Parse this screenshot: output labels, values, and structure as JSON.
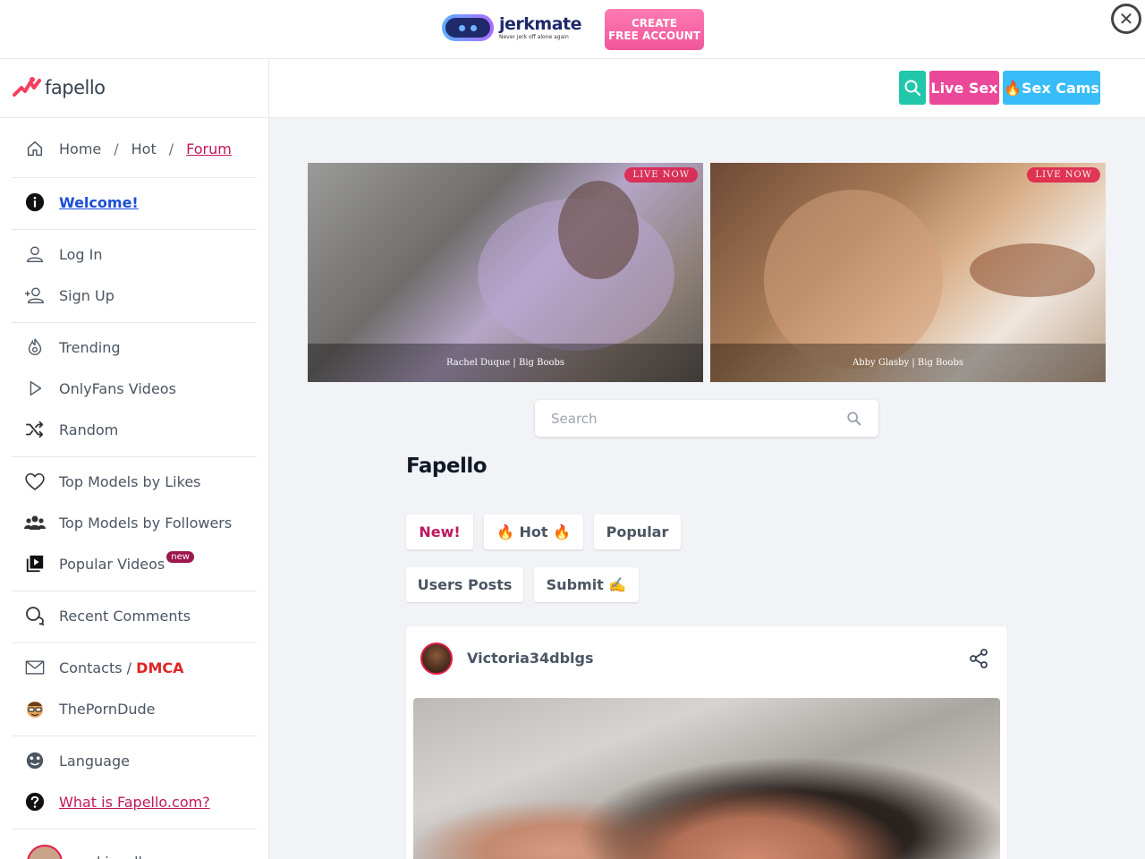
{
  "ad": {
    "brand": "jerkmate",
    "tagline": "Never jerk off alone again",
    "cta_line1": "CREATE",
    "cta_line2": "FREE ACCOUNT",
    "close_icon": "close-icon"
  },
  "header": {
    "logo_text": "fapello",
    "search_icon": "search-icon",
    "live_sex_label": "Live Sex",
    "sex_cams_label": "🔥Sex Cams"
  },
  "breadcrumb": {
    "home": "Home",
    "hot": "Hot",
    "forum": "Forum",
    "separator": "/"
  },
  "sidebar": {
    "welcome": "Welcome!",
    "login": "Log In",
    "signup": "Sign Up",
    "trending": "Trending",
    "onlyfans_videos": "OnlyFans Videos",
    "random": "Random",
    "top_likes": "Top Models by Likes",
    "top_followers": "Top Models by Followers",
    "popular_videos": "Popular Videos",
    "new_badge": "new",
    "recent_comments": "Recent Comments",
    "contacts": "Contacts / ",
    "dmca": "DMCA",
    "theporndude": "ThePornDude",
    "language": "Language",
    "what_is": "What is Fapello.com?",
    "bottom_user": "ankiecollc"
  },
  "promos": [
    {
      "badge": "LIVE NOW",
      "caption": "Rachel Duque | Big Boobs"
    },
    {
      "badge": "LIVE NOW",
      "caption": "Abby Glasby | Big Boobs"
    }
  ],
  "search": {
    "placeholder": "Search"
  },
  "main": {
    "title": "Fapello",
    "tabs": {
      "new": "New!",
      "hot": "🔥 Hot 🔥",
      "popular": "Popular",
      "users_posts": "Users Posts",
      "submit": "Submit ✍️"
    }
  },
  "post": {
    "username": "Victoria34dblgs",
    "share_icon": "share-icon"
  },
  "colors": {
    "accent_pink": "#ec4899",
    "accent_blue": "#38bdf8",
    "accent_teal": "#22c7a9",
    "link_pink": "#c2185b",
    "dmca_red": "#dc2626"
  }
}
